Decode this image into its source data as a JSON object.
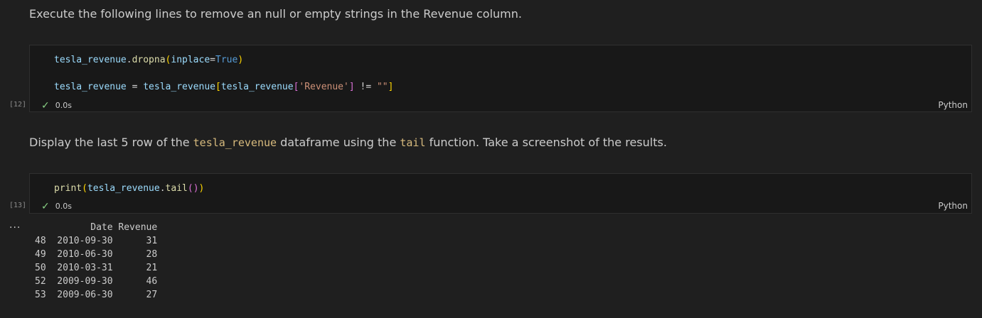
{
  "cells": [
    {
      "type": "markdown",
      "parts": [
        "Execute the following lines to remove an null or empty strings in the Revenue column."
      ]
    },
    {
      "type": "code",
      "execution_count": "[12]",
      "status_time": "0.0s",
      "language": "Python",
      "tokens": {
        "l1_var": "tesla_revenue",
        "l1_dot": ".",
        "l1_fn": "dropna",
        "l1_open": "(",
        "l1_arg": "inplace",
        "l1_eq": "=",
        "l1_val": "True",
        "l1_close": ")",
        "l2_var": "tesla_revenue",
        "l2_assign": " = ",
        "l2_var2": "tesla_revenue",
        "l2_open": "[",
        "l2_var3": "tesla_revenue",
        "l2_open2": "[",
        "l2_str": "'Revenue'",
        "l2_close2": "]",
        "l2_neq": " != ",
        "l2_str2": "\"\"",
        "l2_close": "]"
      }
    },
    {
      "type": "markdown",
      "parts": [
        "Display the last 5 row of the ",
        "tesla_revenue",
        " dataframe using the ",
        "tail",
        " function. Take a screenshot of the results."
      ]
    },
    {
      "type": "code",
      "execution_count": "[13]",
      "status_time": "0.0s",
      "language": "Python",
      "tokens": {
        "fn": "print",
        "open": "(",
        "var": "tesla_revenue",
        "dot": ".",
        "fn2": "tail",
        "open2": "(",
        "close2": ")",
        "close": ")"
      }
    }
  ],
  "output": {
    "ellipsis": "...",
    "header": "          Date Revenue",
    "rows": [
      "48  2010-09-30      31",
      "49  2010-06-30      28",
      "50  2010-03-31      21",
      "52  2009-09-30      46",
      "53  2009-06-30      27"
    ]
  },
  "icons": {
    "success": "check-icon"
  },
  "colors": {
    "background": "#1f1f1f",
    "cell_background": "#181818",
    "success": "#89d185",
    "inline_code": "#d7ba7d"
  }
}
